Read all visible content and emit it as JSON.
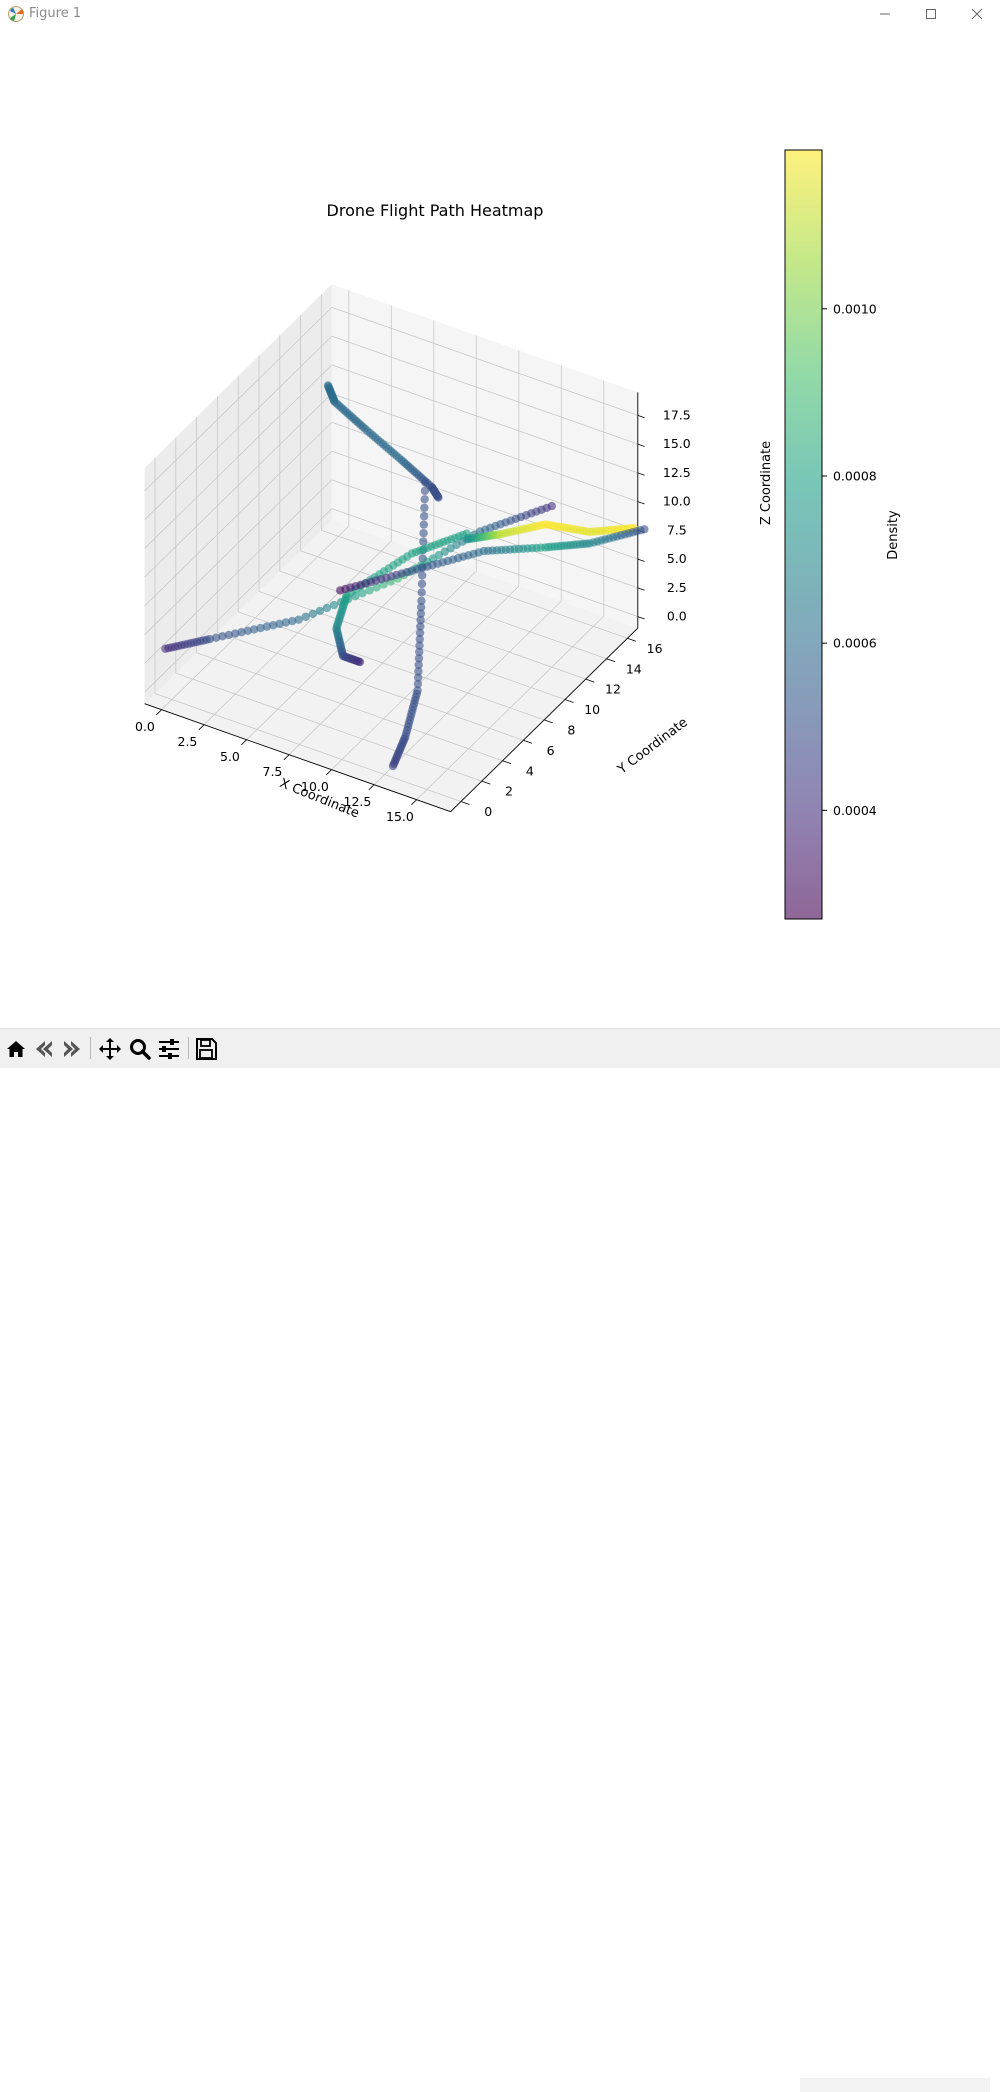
{
  "window": {
    "title": "Figure 1",
    "controls": [
      "minimize",
      "maximize",
      "close"
    ]
  },
  "toolbar": {
    "buttons": [
      {
        "name": "home",
        "icon": "home-icon"
      },
      {
        "name": "back",
        "icon": "back-arrow-icon"
      },
      {
        "name": "forward",
        "icon": "forward-arrow-icon"
      },
      {
        "name": "pan",
        "icon": "move-icon"
      },
      {
        "name": "zoom",
        "icon": "search-icon"
      },
      {
        "name": "configure-subplots",
        "icon": "sliders-icon"
      },
      {
        "name": "save",
        "icon": "floppy-disk-icon"
      }
    ]
  },
  "chart_data": {
    "type": "scatter3d",
    "title": "Drone Flight Path Heatmap",
    "xlabel": "X Coordinate",
    "ylabel": "Y Coordinate",
    "zlabel": "Z Coordinate",
    "xticks": [
      "0.0",
      "2.5",
      "5.0",
      "7.5",
      "10.0",
      "12.5",
      "15.0"
    ],
    "yticks": [
      "0",
      "2",
      "4",
      "6",
      "8",
      "10",
      "12",
      "14",
      "16"
    ],
    "zticks": [
      "0.0",
      "2.5",
      "5.0",
      "7.5",
      "10.0",
      "12.5",
      "15.0",
      "17.5"
    ],
    "xlim": [
      -1,
      17
    ],
    "ylim": [
      -1,
      17
    ],
    "zlim": [
      -1,
      19.5
    ],
    "colormap": "viridis",
    "alpha": 0.6,
    "colorbar": {
      "label": "Density",
      "ticks": [
        "0.0004",
        "0.0006",
        "0.0008",
        "0.0010"
      ],
      "range": [
        0.00027,
        0.00119
      ]
    },
    "paths": [
      {
        "points": [
          [
            0,
            15,
            13
          ],
          [
            1,
            14,
            13
          ],
          [
            4,
            12,
            14
          ],
          [
            8,
            9,
            16
          ],
          [
            11,
            7,
            17
          ],
          [
            12,
            6,
            17.5
          ]
        ],
        "density": [
          0.0006,
          0.0006,
          0.0006,
          0.0006,
          0.0005,
          0.0005
        ]
      },
      {
        "points": [
          [
            10,
            8,
            16
          ],
          [
            11,
            6,
            8
          ],
          [
            12,
            4,
            2.5
          ],
          [
            12.5,
            2,
            0.5
          ],
          [
            13,
            0,
            0
          ]
        ],
        "density": [
          0.0005,
          0.0005,
          0.0005,
          0.0005,
          0.00045
        ]
      },
      {
        "points": [
          [
            15,
            12,
            13
          ],
          [
            12,
            10,
            11
          ],
          [
            9,
            7,
            8
          ],
          [
            5,
            4,
            5
          ],
          [
            1,
            2,
            3
          ],
          [
            -1,
            1,
            2
          ]
        ],
        "density": [
          0.0004,
          0.0006,
          0.0009,
          0.0006,
          0.0005,
          0.0004
        ]
      },
      {
        "points": [
          [
            10,
            12,
            7.5
          ],
          [
            12,
            12,
            9
          ],
          [
            14,
            13,
            10
          ],
          [
            16,
            14,
            9.5
          ],
          [
            18,
            15,
            10
          ]
        ],
        "density": [
          0.0007,
          0.0011,
          0.00119,
          0.00115,
          0.00119
        ]
      },
      {
        "points": [
          [
            10,
            12,
            8
          ],
          [
            8,
            10,
            7
          ],
          [
            6,
            7,
            5
          ],
          [
            6,
            6,
            3
          ],
          [
            7,
            5,
            2
          ],
          [
            8,
            5,
            2
          ]
        ],
        "density": [
          0.0008,
          0.0008,
          0.0008,
          0.0007,
          0.0005,
          0.0004
        ]
      },
      {
        "points": [
          [
            5,
            8,
            4
          ],
          [
            8,
            10,
            5.5
          ],
          [
            11,
            12,
            7
          ],
          [
            14,
            13,
            8
          ],
          [
            16,
            14,
            8.5
          ],
          [
            18,
            16,
            9
          ]
        ],
        "density": [
          0.0003,
          0.0005,
          0.0006,
          0.0008,
          0.0007,
          0.0005
        ]
      }
    ]
  }
}
